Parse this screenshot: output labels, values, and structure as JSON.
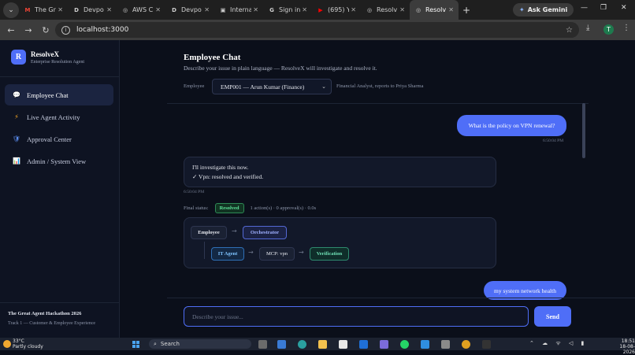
{
  "browser": {
    "tabs": [
      {
        "label": "The Gr",
        "favicon": "gmail-icon",
        "fav_color": "#ea4335",
        "fav_char": "M"
      },
      {
        "label": "Devpo",
        "favicon": "devpost-icon",
        "fav_color": "#1f1f1f",
        "fav_char": "D"
      },
      {
        "label": "AWS C",
        "favicon": "globe-icon",
        "fav_color": "#1f1f1f",
        "fav_char": "◎"
      },
      {
        "label": "Devpo",
        "favicon": "devpost-icon",
        "fav_color": "#1f1f1f",
        "fav_char": "D"
      },
      {
        "label": "Interna",
        "favicon": "page-icon",
        "fav_color": "#1f1f1f",
        "fav_char": "▣"
      },
      {
        "label": "Sign in",
        "favicon": "google-icon",
        "fav_color": "#1f1f1f",
        "fav_char": "G"
      },
      {
        "label": "(695) Y",
        "favicon": "youtube-icon",
        "fav_color": "#ff0000",
        "fav_char": "▶"
      },
      {
        "label": "Resolv",
        "favicon": "globe-icon",
        "fav_color": "#1f1f1f",
        "fav_char": "◎"
      },
      {
        "label": "Resolv",
        "favicon": "globe-icon",
        "fav_color": "#1f1f1f",
        "fav_char": "◎",
        "active": true
      }
    ],
    "new_tab": "+",
    "gemini_label": "Ask Gemini",
    "url": "localhost:3000",
    "profile_initial": "T"
  },
  "sidebar": {
    "brand_initial": "R",
    "brand_name": "ResolveX",
    "brand_sub": "Enterprise Resolution Agent",
    "items": [
      {
        "label": "Employee Chat",
        "icon": "chat-bubble-icon",
        "glyph": "💬",
        "active": true
      },
      {
        "label": "Live Agent Activity",
        "icon": "lightning-icon",
        "glyph": "⚡"
      },
      {
        "label": "Approval Center",
        "icon": "shield-icon",
        "glyph": "🛡"
      },
      {
        "label": "Admin / System View",
        "icon": "bar-chart-icon",
        "glyph": "📊"
      }
    ],
    "footer_title": "The Great Agent Hackathon 2026",
    "footer_sub": "Track 1 — Customer & Employee Experience"
  },
  "main": {
    "title": "Employee Chat",
    "subtitle": "Describe your issue in plain language — ResolveX will investigate and resolve it.",
    "employee_label": "Employee",
    "employee_selected": "EMP001 — Arun Kumar (Finance)",
    "employee_desc": "Financial Analyst, reports to Priya Sharma",
    "messages": {
      "user1": "What is the policy on VPN renewal?",
      "user1_time": "6:50:04 PM",
      "agent_line1": "I'll investigate this now.",
      "agent_line2": "✓ Vpn: resolved and verified.",
      "agent_time": "6:50:04 PM",
      "status_label": "Final status:",
      "status_badge": "Resolved",
      "status_meta": "1 action(s) · 0 approval(s) · 0.0s",
      "user2": "my system network health"
    },
    "flow": {
      "employee": "Employee",
      "orchestrator": "Orchestrator",
      "it_agent": "IT Agent",
      "mcp": "MCP: vpn",
      "verification": "Verification",
      "arrow": "→"
    },
    "composer_placeholder": "Describe your issue...",
    "send_label": "Send"
  },
  "taskbar": {
    "temp": "33°C",
    "weather": "Partly cloudy",
    "search": "Search",
    "time": "18:51",
    "date": "18-08-2026"
  }
}
